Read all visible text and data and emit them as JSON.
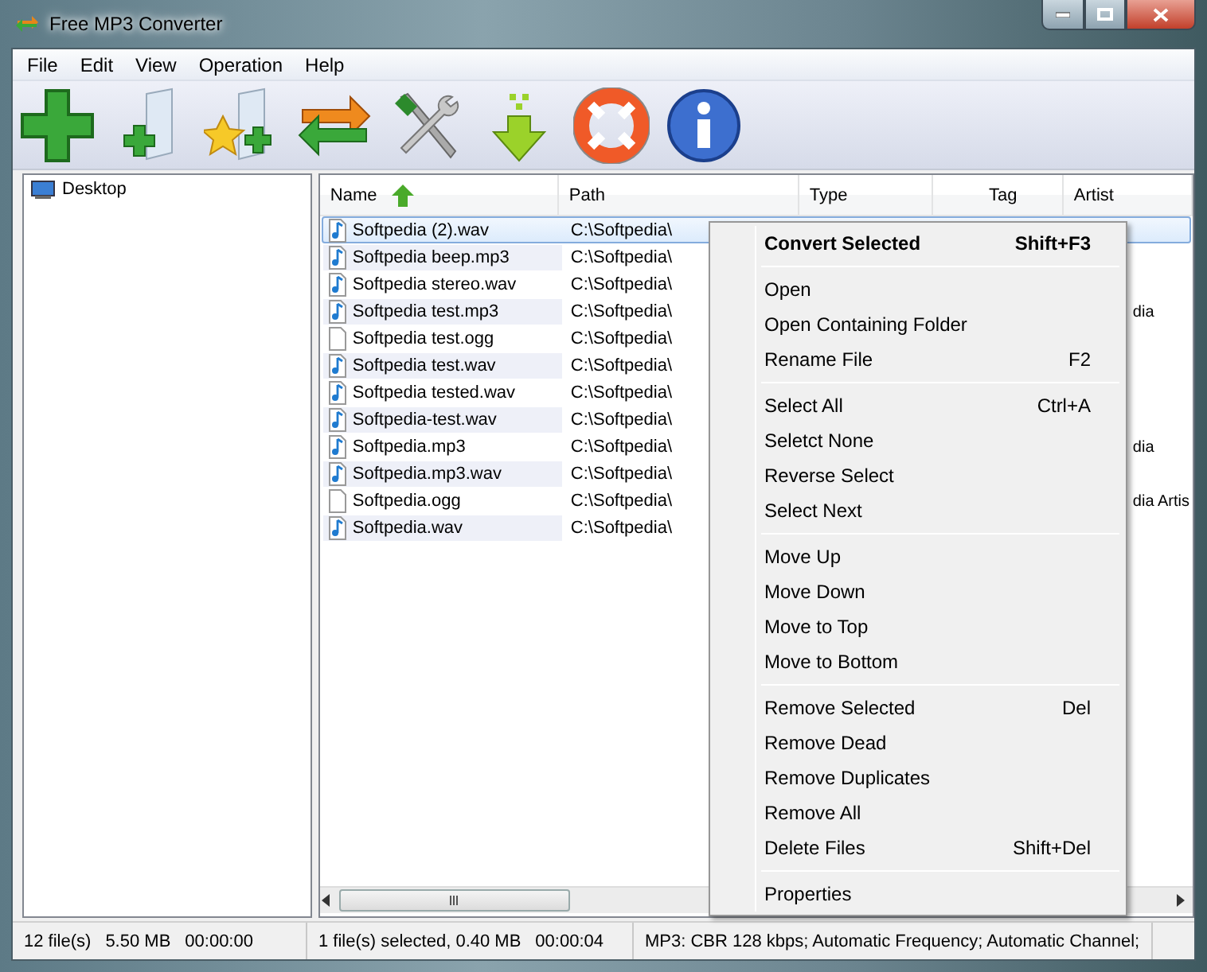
{
  "window": {
    "title": "Free MP3 Converter"
  },
  "menu": [
    "File",
    "Edit",
    "View",
    "Operation",
    "Help"
  ],
  "tree": [
    {
      "label": "Desktop"
    }
  ],
  "table": {
    "columns": [
      {
        "label": "Name",
        "sorted": true
      },
      {
        "label": "Path",
        "sorted": false
      },
      {
        "label": "Type",
        "sorted": false
      },
      {
        "label": "Tag",
        "sorted": false
      },
      {
        "label": "Artist",
        "sorted": false
      }
    ],
    "rows": [
      {
        "name": "Softpedia (2).wav",
        "path": "C:\\Softpedia\\",
        "kind": "audio",
        "selected": true
      },
      {
        "name": "Softpedia beep.mp3",
        "path": "C:\\Softpedia\\",
        "kind": "audio",
        "selected": false
      },
      {
        "name": "Softpedia stereo.wav",
        "path": "C:\\Softpedia\\",
        "kind": "audio",
        "selected": false
      },
      {
        "name": "Softpedia test.mp3",
        "path": "C:\\Softpedia\\",
        "kind": "audio",
        "artist": "dia",
        "selected": false
      },
      {
        "name": "Softpedia test.ogg",
        "path": "C:\\Softpedia\\",
        "kind": "blank",
        "selected": false
      },
      {
        "name": "Softpedia test.wav",
        "path": "C:\\Softpedia\\",
        "kind": "audio",
        "selected": false
      },
      {
        "name": "Softpedia tested.wav",
        "path": "C:\\Softpedia\\",
        "kind": "audio",
        "selected": false
      },
      {
        "name": "Softpedia-test.wav",
        "path": "C:\\Softpedia\\",
        "kind": "audio",
        "selected": false
      },
      {
        "name": "Softpedia.mp3",
        "path": "C:\\Softpedia\\",
        "kind": "audio",
        "artist": "dia",
        "selected": false
      },
      {
        "name": "Softpedia.mp3.wav",
        "path": "C:\\Softpedia\\",
        "kind": "audio",
        "selected": false
      },
      {
        "name": "Softpedia.ogg",
        "path": "C:\\Softpedia\\",
        "kind": "blank",
        "artist": "dia Artis",
        "selected": false
      },
      {
        "name": "Softpedia.wav",
        "path": "C:\\Softpedia\\",
        "kind": "audio",
        "selected": false
      }
    ]
  },
  "context_menu": [
    {
      "kind": "item",
      "label": "Convert Selected",
      "shortcut": "Shift+F3",
      "default": true
    },
    {
      "kind": "separator"
    },
    {
      "kind": "item",
      "label": "Open",
      "default": false
    },
    {
      "kind": "item",
      "label": "Open Containing Folder",
      "default": false
    },
    {
      "kind": "item",
      "label": "Rename File",
      "shortcut": "F2",
      "default": false
    },
    {
      "kind": "separator"
    },
    {
      "kind": "item",
      "label": "Select All",
      "shortcut": "Ctrl+A",
      "default": false
    },
    {
      "kind": "item",
      "label": "Seletct None",
      "default": false
    },
    {
      "kind": "item",
      "label": "Reverse Select",
      "default": false
    },
    {
      "kind": "item",
      "label": "Select Next",
      "default": false
    },
    {
      "kind": "separator"
    },
    {
      "kind": "item",
      "label": "Move Up",
      "default": false
    },
    {
      "kind": "item",
      "label": "Move Down",
      "default": false
    },
    {
      "kind": "item",
      "label": "Move to Top",
      "default": false
    },
    {
      "kind": "item",
      "label": "Move to Bottom",
      "default": false
    },
    {
      "kind": "separator"
    },
    {
      "kind": "item",
      "label": "Remove Selected",
      "shortcut": "Del",
      "default": false
    },
    {
      "kind": "item",
      "label": "Remove Dead",
      "default": false
    },
    {
      "kind": "item",
      "label": "Remove Duplicates",
      "default": false
    },
    {
      "kind": "item",
      "label": "Remove All",
      "default": false
    },
    {
      "kind": "item",
      "label": "Delete Files",
      "shortcut": "Shift+Del",
      "default": false
    },
    {
      "kind": "separator"
    },
    {
      "kind": "item",
      "label": "Properties",
      "default": false
    }
  ],
  "status_bar": [
    [
      "12 file(s)",
      "5.50 MB",
      "00:00:00"
    ],
    [
      "1 file(s) selected, 0.40 MB",
      "00:00:04"
    ],
    [
      "MP3:  CBR 128 kbps; Automatic Frequency; Automatic Channel;"
    ]
  ]
}
